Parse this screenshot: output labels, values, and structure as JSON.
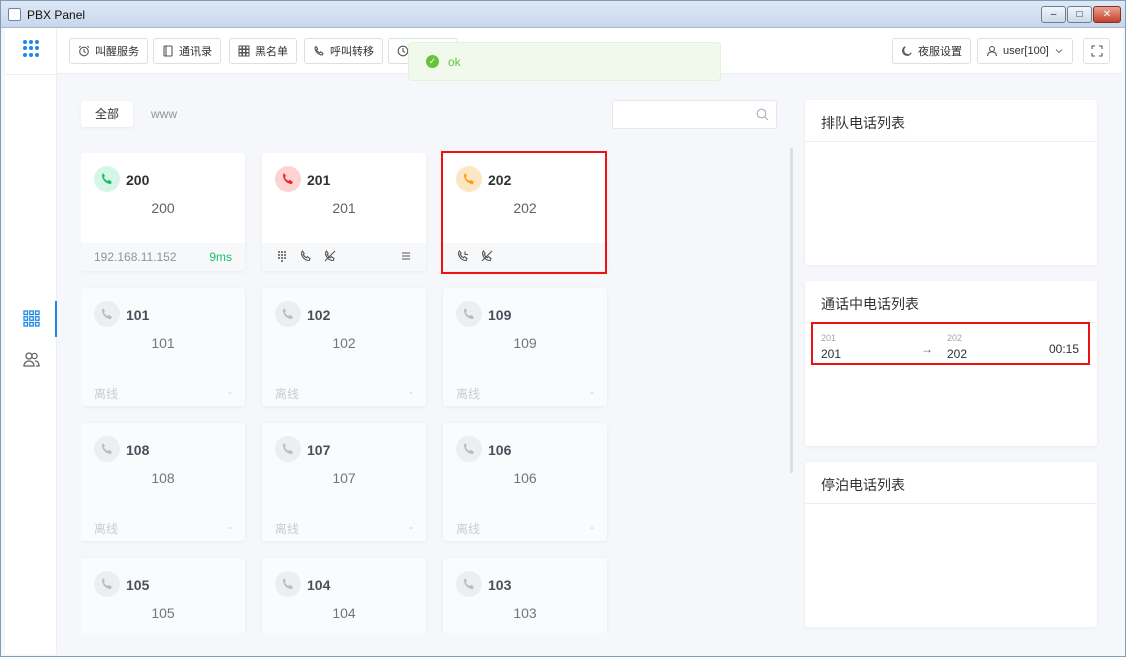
{
  "window": {
    "title": "PBX Panel"
  },
  "toolbar": {
    "wakeup": "叫醒服务",
    "contacts": "通讯录",
    "blacklist": "黑名单",
    "forward": "呼叫转移",
    "night": "夜服设置",
    "user": "user[100]"
  },
  "toast": {
    "message": "ok"
  },
  "tabs": [
    "全部",
    "www"
  ],
  "search": {
    "placeholder": ""
  },
  "extensions": [
    {
      "ext": "200",
      "name": "200",
      "status": "idle",
      "ip": "192.168.11.152",
      "latency": "9ms"
    },
    {
      "ext": "201",
      "name": "201",
      "status": "busy"
    },
    {
      "ext": "202",
      "name": "202",
      "status": "ringing"
    },
    {
      "ext": "101",
      "name": "101",
      "status": "offline",
      "state": "离线",
      "extra": "-"
    },
    {
      "ext": "102",
      "name": "102",
      "status": "offline",
      "state": "离线",
      "extra": "-"
    },
    {
      "ext": "109",
      "name": "109",
      "status": "offline",
      "state": "离线",
      "extra": "-"
    },
    {
      "ext": "108",
      "name": "108",
      "status": "offline",
      "state": "离线",
      "extra": "-"
    },
    {
      "ext": "107",
      "name": "107",
      "status": "offline",
      "state": "离线",
      "extra": "-"
    },
    {
      "ext": "106",
      "name": "106",
      "status": "offline",
      "state": "离线",
      "extra": "-"
    },
    {
      "ext": "105",
      "name": "105",
      "status": "offline"
    },
    {
      "ext": "104",
      "name": "104",
      "status": "offline"
    },
    {
      "ext": "103",
      "name": "103",
      "status": "offline"
    }
  ],
  "panels": {
    "queue": {
      "title": "排队电话列表"
    },
    "active": {
      "title": "通话中电话列表",
      "calls": [
        {
          "from_ext": "201",
          "from_name": "201",
          "to_ext": "202",
          "to_name": "202",
          "duration": "00:15"
        }
      ]
    },
    "parked": {
      "title": "停泊电话列表"
    }
  },
  "colors": {
    "accent": "#1e88e5",
    "idle": "#19be6b",
    "busy": "#f5222d",
    "ringing": "#fa9e14",
    "offline": "#b8bcc4"
  }
}
